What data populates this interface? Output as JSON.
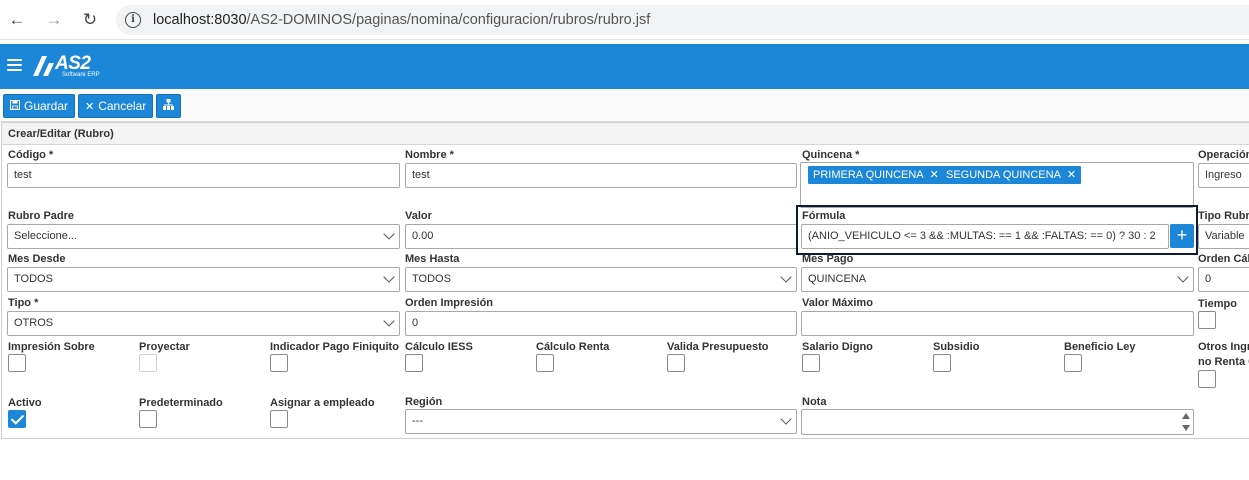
{
  "browser": {
    "url_host": "localhost:8030",
    "url_path": "/AS2-DOMINOS/paginas/nomina/configuracion/rubros/rubro.jsf"
  },
  "app": {
    "logo_text": "AS2",
    "logo_sub": "Software ERP"
  },
  "toolbar": {
    "save_label": "Guardar",
    "cancel_label": "Cancelar"
  },
  "panel": {
    "title": "Crear/Editar (Rubro)"
  },
  "form": {
    "codigo": {
      "label": "Código *",
      "value": "test"
    },
    "nombre": {
      "label": "Nombre *",
      "value": "test"
    },
    "quincena": {
      "label": "Quincena *",
      "chips": [
        "PRIMERA QUINCENA",
        "SEGUNDA QUINCENA"
      ]
    },
    "operacion": {
      "label": "Operación",
      "value": "Ingreso"
    },
    "rubro_padre": {
      "label": "Rubro Padre",
      "value": "Seleccione..."
    },
    "valor": {
      "label": "Valor",
      "value": "0.00"
    },
    "formula": {
      "label": "Fórmula",
      "value": "(ANIO_VEHICULO <= 3 && :MULTAS: == 1 && :FALTAS: == 0) ? 30 : 2"
    },
    "tipo_rubro": {
      "label": "Tipo Rubr",
      "value": "Variable"
    },
    "mes_desde": {
      "label": "Mes Desde",
      "value": "TODOS"
    },
    "mes_hasta": {
      "label": "Mes Hasta",
      "value": "TODOS"
    },
    "mes_pago": {
      "label": "Mes Pago",
      "value": "QUINCENA"
    },
    "orden_calculo": {
      "label": "Orden Cálc",
      "value": "0"
    },
    "tipo": {
      "label": "Tipo *",
      "value": "OTROS"
    },
    "orden_impresion": {
      "label": "Orden Impresión",
      "value": "0"
    },
    "valor_maximo": {
      "label": "Valor Máximo",
      "value": ""
    },
    "tiempo": {
      "label": "Tiempo"
    },
    "impresion_sobre": {
      "label": "Impresión Sobre"
    },
    "proyectar": {
      "label": "Proyectar"
    },
    "indicador_pago_finiquito": {
      "label": "Indicador Pago Finiquito"
    },
    "calculo_iess": {
      "label": "Cálculo IESS"
    },
    "calculo_renta": {
      "label": "Cálculo Renta"
    },
    "valida_presupuesto": {
      "label": "Valida Presupuesto"
    },
    "salario_digno": {
      "label": "Salario Digno"
    },
    "subsidio": {
      "label": "Subsidio"
    },
    "beneficio_ley": {
      "label": "Beneficio Ley"
    },
    "otros_ingresos": {
      "label_line1": "Otros Ingr",
      "label_line2": "no Renta C"
    },
    "activo": {
      "label": "Activo",
      "checked": true
    },
    "predeterminado": {
      "label": "Predeterminado"
    },
    "asignar_empleado": {
      "label": "Asignar a empleado"
    },
    "region": {
      "label": "Región",
      "value": "---"
    },
    "nota": {
      "label": "Nota",
      "value": ""
    }
  },
  "colors": {
    "primary": "#1c87d8",
    "focus_border": "#0c1a3c"
  }
}
